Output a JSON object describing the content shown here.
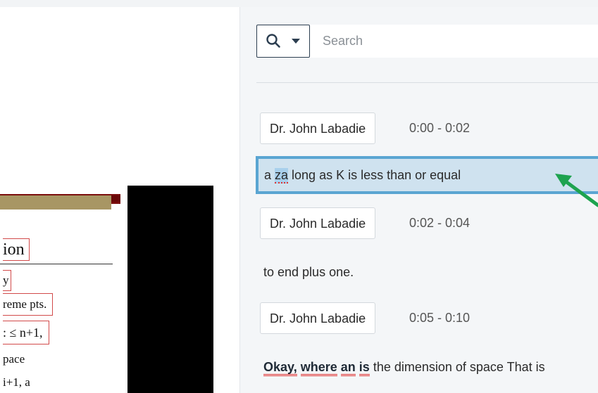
{
  "colors": {
    "accent": "#5aa5d2",
    "active_bg": "#cfe2ef",
    "arrow": "#1ea34f",
    "spell_underline": "#e03030"
  },
  "search": {
    "placeholder": "Search",
    "value": "",
    "filter_icon": "search-icon",
    "dropdown_icon": "caret-down-icon"
  },
  "slide": {
    "lines": [
      "ion",
      "y",
      "reme pts.",
      ": ≤ n+1,",
      "pace",
      "i+1, a"
    ]
  },
  "transcript": {
    "entries": [
      {
        "speaker": "Dr. John Labadie",
        "time": "0:00 - 0:02",
        "text_pre": "a ",
        "text_highlight": "za",
        "text_post": " long as K is less than or equal",
        "active": true
      },
      {
        "speaker": "Dr. John Labadie",
        "time": "0:02 - 0:04",
        "text": "to end plus one.",
        "active": false
      },
      {
        "speaker": "Dr. John Labadie",
        "time": "0:05 - 0:10",
        "text_keywords": [
          "Okay,",
          "where",
          "an",
          "is"
        ],
        "text_post": " the dimension of space That is",
        "active": false
      }
    ]
  },
  "annotation": {
    "icon": "arrow-icon"
  }
}
